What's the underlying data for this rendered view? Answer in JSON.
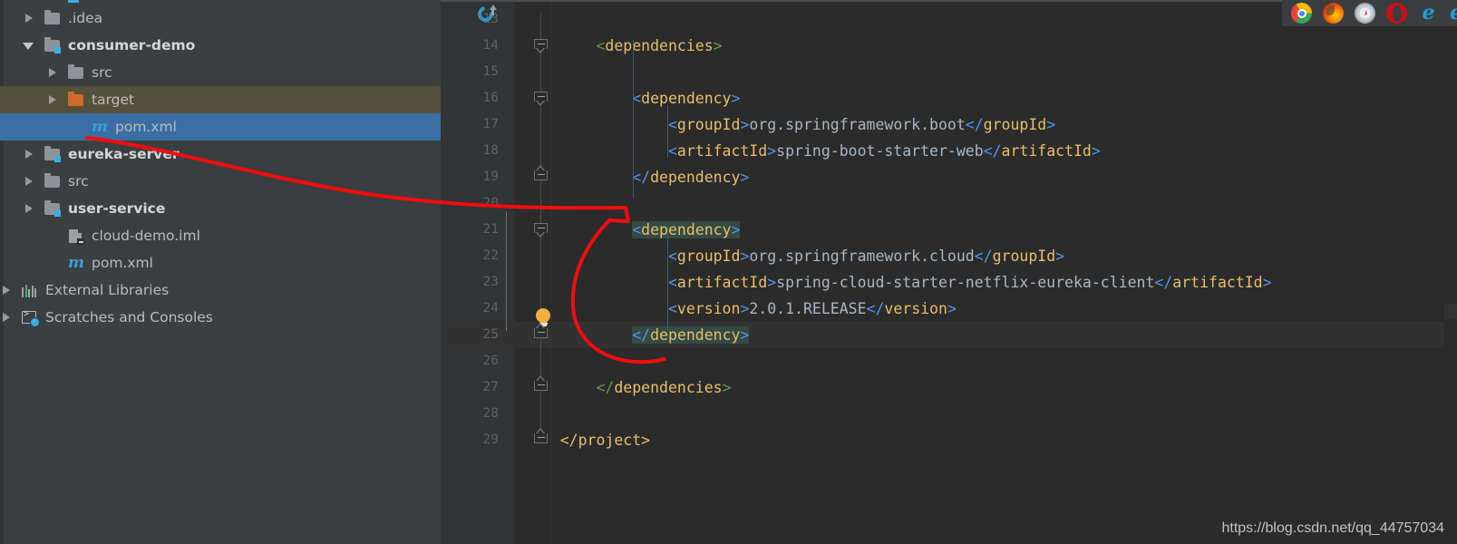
{
  "sidebar": {
    "items": [
      {
        "label": ".idea",
        "icon": "folder-icon",
        "arrow": "right",
        "indent": 38,
        "bold": false,
        "state": "none"
      },
      {
        "label": "consumer-demo",
        "icon": "module-folder-icon",
        "arrow": "down",
        "indent": 38,
        "bold": true,
        "state": "none"
      },
      {
        "label": "src",
        "icon": "folder-icon",
        "arrow": "right",
        "indent": 64,
        "bold": false,
        "state": "none"
      },
      {
        "label": "target",
        "icon": "excluded-folder-icon",
        "arrow": "right",
        "indent": 64,
        "bold": false,
        "state": "hover"
      },
      {
        "label": "pom.xml",
        "icon": "maven-file-icon",
        "arrow": "none",
        "indent": 90,
        "bold": false,
        "state": "selected"
      },
      {
        "label": "eureka-server",
        "icon": "module-folder-icon",
        "arrow": "right",
        "indent": 38,
        "bold": true,
        "state": "none"
      },
      {
        "label": "src",
        "icon": "folder-icon",
        "arrow": "right",
        "indent": 38,
        "bold": false,
        "state": "none"
      },
      {
        "label": "user-service",
        "icon": "module-folder-icon",
        "arrow": "right",
        "indent": 38,
        "bold": true,
        "state": "none"
      },
      {
        "label": "cloud-demo.iml",
        "icon": "iml-file-icon",
        "arrow": "none",
        "indent": 64,
        "bold": false,
        "state": "none"
      },
      {
        "label": "pom.xml",
        "icon": "maven-file-icon",
        "arrow": "none",
        "indent": 64,
        "bold": false,
        "state": "none"
      },
      {
        "label": "External Libraries",
        "icon": "libraries-icon",
        "arrow": "right",
        "indent": 10,
        "bold": false,
        "state": "none"
      },
      {
        "label": "Scratches and Consoles",
        "icon": "scratches-icon",
        "arrow": "right",
        "indent": 10,
        "bold": false,
        "state": "none"
      }
    ]
  },
  "editor": {
    "first_line": 13,
    "lines": [
      {
        "n": 13,
        "segments": []
      },
      {
        "n": 14,
        "segments": [
          {
            "t": "        ",
            "c": "val"
          },
          {
            "t": "<",
            "c": "brkg"
          },
          {
            "t": "dependencies",
            "c": "tag"
          },
          {
            "t": ">",
            "c": "brkg"
          }
        ]
      },
      {
        "n": 15,
        "segments": []
      },
      {
        "n": 16,
        "segments": [
          {
            "t": "            ",
            "c": "val"
          },
          {
            "t": "<",
            "c": "brk"
          },
          {
            "t": "dependency",
            "c": "tag"
          },
          {
            "t": ">",
            "c": "brk"
          }
        ]
      },
      {
        "n": 17,
        "segments": [
          {
            "t": "                ",
            "c": "val"
          },
          {
            "t": "<",
            "c": "brk"
          },
          {
            "t": "groupId",
            "c": "tag"
          },
          {
            "t": ">",
            "c": "brk"
          },
          {
            "t": "org.springframework.boot",
            "c": "val"
          },
          {
            "t": "</",
            "c": "brk"
          },
          {
            "t": "groupId",
            "c": "tag"
          },
          {
            "t": ">",
            "c": "brk"
          }
        ]
      },
      {
        "n": 18,
        "segments": [
          {
            "t": "                ",
            "c": "val"
          },
          {
            "t": "<",
            "c": "brk"
          },
          {
            "t": "artifactId",
            "c": "tag"
          },
          {
            "t": ">",
            "c": "brk"
          },
          {
            "t": "spring-boot-starter-web",
            "c": "val"
          },
          {
            "t": "</",
            "c": "brk"
          },
          {
            "t": "artifactId",
            "c": "tag"
          },
          {
            "t": ">",
            "c": "brk"
          }
        ]
      },
      {
        "n": 19,
        "segments": [
          {
            "t": "            ",
            "c": "val"
          },
          {
            "t": "</",
            "c": "brk"
          },
          {
            "t": "dependency",
            "c": "tag"
          },
          {
            "t": ">",
            "c": "brk"
          }
        ]
      },
      {
        "n": 20,
        "segments": []
      },
      {
        "n": 21,
        "segments": [
          {
            "t": "            ",
            "c": "val"
          },
          {
            "t": "<",
            "c": "brk",
            "hl": true
          },
          {
            "t": "dependency",
            "c": "tag",
            "hl": true
          },
          {
            "t": ">",
            "c": "brk",
            "hl": true
          }
        ]
      },
      {
        "n": 22,
        "segments": [
          {
            "t": "                ",
            "c": "val"
          },
          {
            "t": "<",
            "c": "brk"
          },
          {
            "t": "groupId",
            "c": "tag"
          },
          {
            "t": ">",
            "c": "brk"
          },
          {
            "t": "org.springframework.cloud",
            "c": "val"
          },
          {
            "t": "</",
            "c": "brk"
          },
          {
            "t": "groupId",
            "c": "tag"
          },
          {
            "t": ">",
            "c": "brk"
          }
        ]
      },
      {
        "n": 23,
        "segments": [
          {
            "t": "                ",
            "c": "val"
          },
          {
            "t": "<",
            "c": "brk"
          },
          {
            "t": "artifactId",
            "c": "tag"
          },
          {
            "t": ">",
            "c": "brk"
          },
          {
            "t": "spring-cloud-starter-netflix-eureka-client",
            "c": "val"
          },
          {
            "t": "</",
            "c": "brk"
          },
          {
            "t": "artifactId",
            "c": "tag"
          },
          {
            "t": ">",
            "c": "brk"
          }
        ]
      },
      {
        "n": 24,
        "segments": [
          {
            "t": "                ",
            "c": "val"
          },
          {
            "t": "<",
            "c": "brk"
          },
          {
            "t": "version",
            "c": "tag"
          },
          {
            "t": ">",
            "c": "brk"
          },
          {
            "t": "2.0.1.RELEASE",
            "c": "val"
          },
          {
            "t": "</",
            "c": "brk"
          },
          {
            "t": "version",
            "c": "tag"
          },
          {
            "t": ">",
            "c": "brk"
          }
        ]
      },
      {
        "n": 25,
        "caret": true,
        "segments": [
          {
            "t": "            ",
            "c": "val"
          },
          {
            "t": "</",
            "c": "brk",
            "hl": true
          },
          {
            "t": "dependency",
            "c": "tag",
            "hl": true
          },
          {
            "t": ">",
            "c": "brk",
            "hl": true
          }
        ]
      },
      {
        "n": 26,
        "segments": []
      },
      {
        "n": 27,
        "segments": [
          {
            "t": "        ",
            "c": "val"
          },
          {
            "t": "</",
            "c": "brkg"
          },
          {
            "t": "dependencies",
            "c": "tag"
          },
          {
            "t": ">",
            "c": "brkg"
          }
        ]
      },
      {
        "n": 28,
        "segments": []
      },
      {
        "n": 29,
        "segments": [
          {
            "t": "    ",
            "c": "val"
          },
          {
            "t": "</",
            "c": "tag"
          },
          {
            "t": "project",
            "c": "tag"
          },
          {
            "t": ">",
            "c": "tag"
          }
        ]
      }
    ]
  },
  "browsers": [
    {
      "name": "chrome-icon",
      "cls": "chrome"
    },
    {
      "name": "firefox-icon",
      "cls": "firefox"
    },
    {
      "name": "safari-icon",
      "cls": "safari"
    },
    {
      "name": "opera-icon",
      "cls": "opera"
    },
    {
      "name": "ie-icon",
      "cls": "ie",
      "glyph": "e"
    },
    {
      "name": "edge-icon",
      "cls": "ie2",
      "glyph": "e"
    }
  ],
  "watermark": "https://blog.csdn.net/qq_44757034",
  "colors": {
    "editor_bg": "#2b2b2b",
    "sidebar_bg": "#3c3f41",
    "selection_blue": "#3a6ea5",
    "hover_olive": "#55503a",
    "tag": "#e8bf6a",
    "bracket": "#5394ec",
    "bracket_green": "#629755",
    "text": "#a9b7c6",
    "search_highlight": "#344a44",
    "annotation_red": "#f20d0d"
  }
}
